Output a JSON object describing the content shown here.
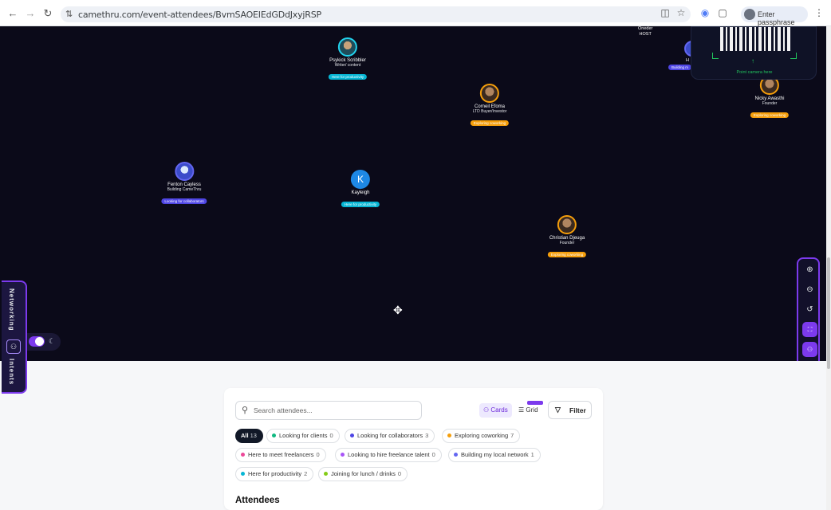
{
  "browser": {
    "url": "camethru.com/event-attendees/BvmSAOEIEdGDdJxyjRSP",
    "passphrase_label": "Enter passphrase"
  },
  "canvas": {
    "host": {
      "name": "Oneder",
      "role": "HOST"
    },
    "partial_node": {
      "name": "H",
      "tag": "Building m"
    },
    "qr_hint": "Point camera here",
    "nodes": [
      {
        "name": "Psykick Scribbler",
        "role": "Writer/ content",
        "tag": "Here for productivity",
        "tag_color": "cyan",
        "avatar": "teal"
      },
      {
        "name": "Corneil Efoma",
        "role": "LTD Buyer/Investor",
        "tag": "Exploring coworking",
        "tag_color": "orange",
        "avatar": "gold"
      },
      {
        "name": "Nicky Awasthi",
        "role": "Founder",
        "tag": "Exploring coworking",
        "tag_color": "orange",
        "avatar": "gold"
      },
      {
        "name": "Fenton Cayless",
        "role": "Building CameThru",
        "tag": "Looking for collaborators",
        "tag_color": "indigo",
        "avatar": "blue"
      },
      {
        "name": "Kayleigh",
        "role": "",
        "tag": "Here for productivity",
        "tag_color": "cyan",
        "avatar": "letter",
        "letter": "K"
      },
      {
        "name": "Christian Djeuga",
        "role": "Founder",
        "tag": "Exploring coworking",
        "tag_color": "orange",
        "avatar": "gold"
      }
    ],
    "side_tab": {
      "top_label": "Networking",
      "bottom_label": "Intents"
    }
  },
  "panel": {
    "search_placeholder": "Search attendees...",
    "view_cards": "Cards",
    "view_grid": "Grid",
    "new_badge": "Partial",
    "filter_label": "Filter",
    "chips": [
      {
        "label": "All",
        "count": "13",
        "color": ""
      },
      {
        "label": "Looking for clients",
        "count": "0",
        "color": "#10b981"
      },
      {
        "label": "Looking for collaborators",
        "count": "3",
        "color": "#4f46e5"
      },
      {
        "label": "Exploring coworking",
        "count": "7",
        "color": "#f59e0b"
      },
      {
        "label": "Here to meet freelancers",
        "count": "0",
        "color": "#ec4899"
      },
      {
        "label": "Looking to hire freelance talent",
        "count": "0",
        "color": "#a855f7"
      },
      {
        "label": "Building my local network",
        "count": "1",
        "color": "#6366f1"
      },
      {
        "label": "Here for productivity",
        "count": "2",
        "color": "#06b6d4"
      },
      {
        "label": "Joining for lunch / drinks",
        "count": "0",
        "color": "#84cc16"
      }
    ],
    "section_title": "Attendees"
  },
  "colors": {
    "accent": "#7c3aed",
    "canvas_bg": "#0b0a19"
  }
}
